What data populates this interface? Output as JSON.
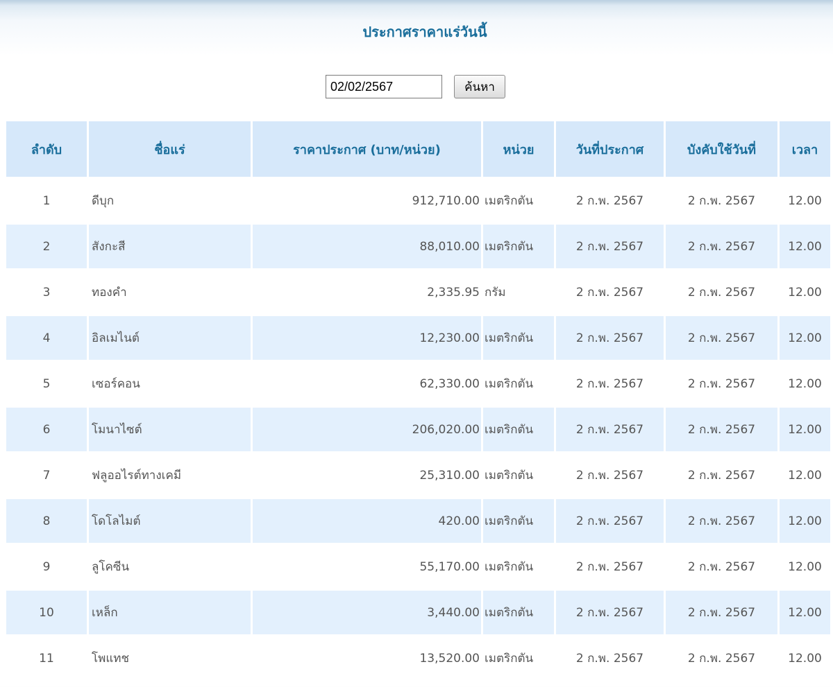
{
  "page": {
    "title": "ประกาศราคาแร่วันนี้"
  },
  "search": {
    "date_value": "02/02/2567",
    "button_label": "ค้นหา"
  },
  "table": {
    "headers": {
      "seq": "ลำดับ",
      "name": "ชื่อแร่",
      "price": "ราคาประกาศ (บาท/หน่วย)",
      "unit": "หน่วย",
      "announce_date": "วันที่ประกาศ",
      "effective_date": "บังคับใช้วันที่",
      "time": "เวลา"
    },
    "rows": [
      {
        "seq": "1",
        "name": "ดีบุก",
        "price": "912,710.00",
        "unit": "เมตริกตัน",
        "announce_date": "2 ก.พ. 2567",
        "effective_date": "2 ก.พ. 2567",
        "time": "12.00"
      },
      {
        "seq": "2",
        "name": "สังกะสี",
        "price": "88,010.00",
        "unit": "เมตริกตัน",
        "announce_date": "2 ก.พ. 2567",
        "effective_date": "2 ก.พ. 2567",
        "time": "12.00"
      },
      {
        "seq": "3",
        "name": "ทองคำ",
        "price": "2,335.95",
        "unit": "กรัม",
        "announce_date": "2 ก.พ. 2567",
        "effective_date": "2 ก.พ. 2567",
        "time": "12.00"
      },
      {
        "seq": "4",
        "name": "อิลเมไนต์",
        "price": "12,230.00",
        "unit": "เมตริกตัน",
        "announce_date": "2 ก.พ. 2567",
        "effective_date": "2 ก.พ. 2567",
        "time": "12.00"
      },
      {
        "seq": "5",
        "name": "เซอร์คอน",
        "price": "62,330.00",
        "unit": "เมตริกตัน",
        "announce_date": "2 ก.พ. 2567",
        "effective_date": "2 ก.พ. 2567",
        "time": "12.00"
      },
      {
        "seq": "6",
        "name": "โมนาไซต์",
        "price": "206,020.00",
        "unit": "เมตริกตัน",
        "announce_date": "2 ก.พ. 2567",
        "effective_date": "2 ก.พ. 2567",
        "time": "12.00"
      },
      {
        "seq": "7",
        "name": "ฟลูออไรต์ทางเคมี",
        "price": "25,310.00",
        "unit": "เมตริกตัน",
        "announce_date": "2 ก.พ. 2567",
        "effective_date": "2 ก.พ. 2567",
        "time": "12.00"
      },
      {
        "seq": "8",
        "name": "โดโลไมต์",
        "price": "420.00",
        "unit": "เมตริกตัน",
        "announce_date": "2 ก.พ. 2567",
        "effective_date": "2 ก.พ. 2567",
        "time": "12.00"
      },
      {
        "seq": "9",
        "name": "ลูโคซีน",
        "price": "55,170.00",
        "unit": "เมตริกตัน",
        "announce_date": "2 ก.พ. 2567",
        "effective_date": "2 ก.พ. 2567",
        "time": "12.00"
      },
      {
        "seq": "10",
        "name": "เหล็ก",
        "price": "3,440.00",
        "unit": "เมตริกตัน",
        "announce_date": "2 ก.พ. 2567",
        "effective_date": "2 ก.พ. 2567",
        "time": "12.00"
      },
      {
        "seq": "11",
        "name": "โพแทช",
        "price": "13,520.00",
        "unit": "เมตริกตัน",
        "announce_date": "2 ก.พ. 2567",
        "effective_date": "2 ก.พ. 2567",
        "time": "12.00"
      }
    ]
  }
}
